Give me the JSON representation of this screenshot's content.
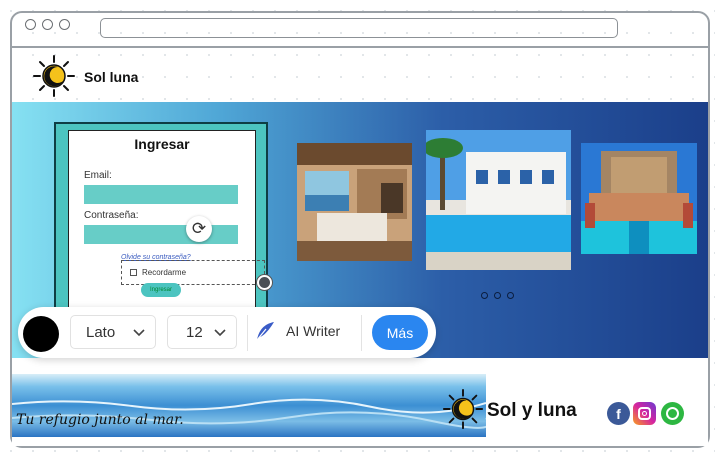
{
  "header": {
    "brand": "Sol luna"
  },
  "login": {
    "title": "Ingresar",
    "email_label": "Email:",
    "password_label": "Contraseña:",
    "forgot": "Olvide su contraseña?",
    "remember": "Recordarme",
    "submit": "Ingresar"
  },
  "carousel": {
    "dots": 3
  },
  "toolbar": {
    "color": "#000000",
    "font": "Lato",
    "size": "12",
    "ai_label": "AI Writer",
    "more_label": "Más"
  },
  "footer": {
    "tagline": "Tu refugio junto al mar.",
    "brand": "Sol y luna",
    "social": [
      "facebook-icon",
      "instagram-icon",
      "whatsapp-icon"
    ]
  },
  "colors": {
    "accent": "#2a86f0",
    "teal": "#4cc4c0",
    "field": "#67cdc7"
  }
}
